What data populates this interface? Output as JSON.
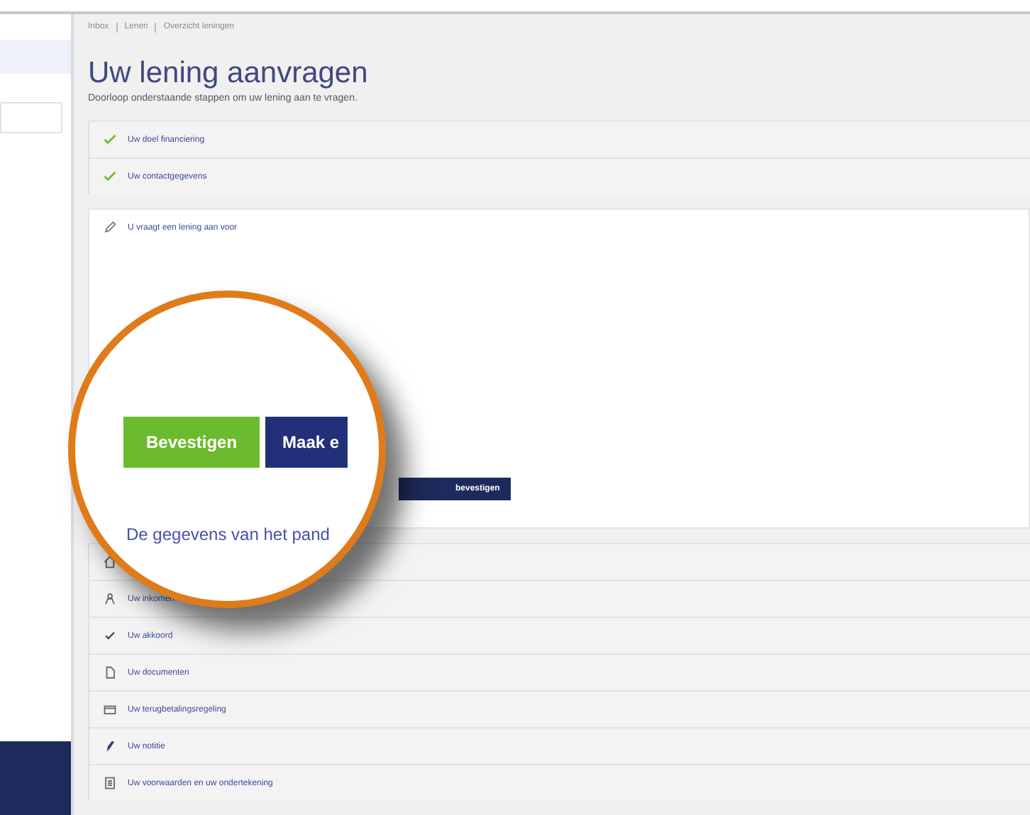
{
  "breadcrumb": [
    "Inbox",
    "Lenen",
    "Overzicht leningen"
  ],
  "title": "Uw lening aanvragen",
  "subtitle": "Doorloop onderstaande stappen om uw lening aan te vragen.",
  "steps": [
    {
      "label": "Uw doel financiering",
      "kind": "done",
      "expanded": false
    },
    {
      "label": "Uw contactgegevens",
      "kind": "done",
      "expanded": false
    },
    {
      "label": "U vraagt een lening aan voor",
      "kind": "edit",
      "expanded": true,
      "button": "bevestigen"
    },
    {
      "kind": "home",
      "expanded": false
    },
    {
      "label": "Uw inkomen",
      "kind": "person",
      "expanded": false
    },
    {
      "label": "Uw akkoord",
      "kind": "tick",
      "expanded": false
    },
    {
      "label": "Uw documenten",
      "kind": "doc",
      "expanded": false
    },
    {
      "label": "Uw terugbetalingsregeling",
      "kind": "card",
      "expanded": false
    },
    {
      "label": "Uw notitie",
      "kind": "pen",
      "expanded": false
    },
    {
      "label": "Uw voorwaarden en uw ondertekening",
      "kind": "list",
      "expanded": false
    }
  ],
  "magnifier": {
    "buttons": [
      {
        "label": "Bevestigen",
        "kind": "primary"
      },
      {
        "label": "Maak e",
        "kind": "secondary"
      }
    ],
    "caption": "De gegevens van het pand"
  }
}
